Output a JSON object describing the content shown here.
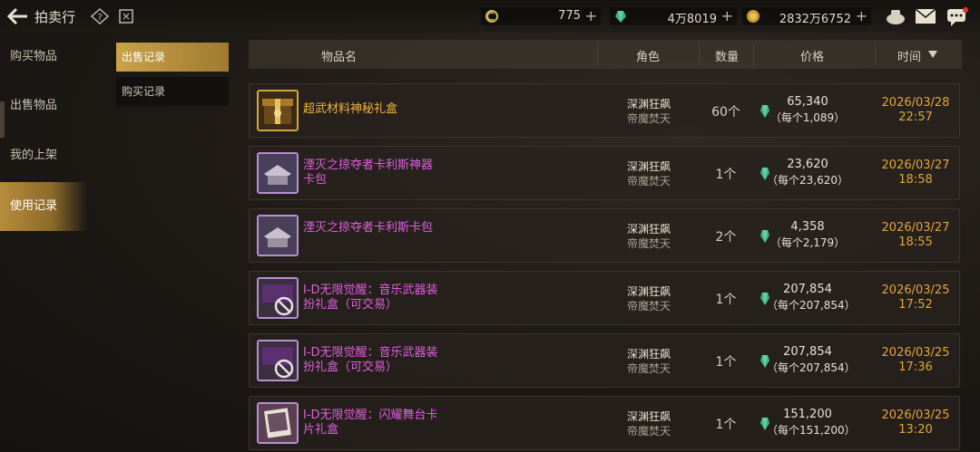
{
  "header": {
    "title": "拍卖行",
    "currencies": [
      {
        "icon": "coin-icon",
        "value": "775"
      },
      {
        "icon": "gem-icon",
        "value": "4万8019"
      },
      {
        "icon": "gold-icon",
        "value": "2832万6752"
      }
    ],
    "plus": "+"
  },
  "leftnav": {
    "items": [
      {
        "label": "购买物品"
      },
      {
        "label": "出售物品"
      },
      {
        "label": "我的上架"
      },
      {
        "label": "使用记录"
      }
    ],
    "active_index": 3
  },
  "subnav": {
    "items": [
      {
        "label": "出售记录"
      },
      {
        "label": "购买记录"
      }
    ],
    "active_index": 0
  },
  "table": {
    "headers": {
      "name": "物品名",
      "role": "角色",
      "qty": "数量",
      "price": "价格",
      "time": "时间"
    },
    "rows": [
      {
        "name": "超武材料神秘礼盒",
        "name_color": "#f0b23a",
        "icon": "mystery-box-icon",
        "role": "深渊狂飙",
        "server": "帝魔焚天",
        "qty": "60个",
        "price": "65,340",
        "unit_price": "（每个1,089）",
        "date": "2026/03/28",
        "time": "22:57"
      },
      {
        "name": "湮灭之掠夺者卡利斯神器卡包",
        "name_color": "#e05ee0",
        "icon": "card-pack-icon",
        "role": "深渊狂飙",
        "server": "帝魔焚天",
        "qty": "1个",
        "price": "23,620",
        "unit_price": "（每个23,620）",
        "date": "2026/03/27",
        "time": "18:58"
      },
      {
        "name": "湮灭之掠夺者卡利斯卡包",
        "name_color": "#e05ee0",
        "icon": "card-pack-icon",
        "role": "深渊狂飙",
        "server": "帝魔焚天",
        "qty": "2个",
        "price": "4,358",
        "unit_price": "（每个2,179）",
        "date": "2026/03/27",
        "time": "18:55"
      },
      {
        "name": "I-D无限觉醒：音乐武器装扮礼盒（可交易）",
        "name_color": "#e05ee0",
        "icon": "weapon-skin-box-icon",
        "role": "深渊狂飙",
        "server": "帝魔焚天",
        "qty": "1个",
        "price": "207,854",
        "unit_price": "（每个207,854）",
        "date": "2026/03/25",
        "time": "17:52"
      },
      {
        "name": "I-D无限觉醒：音乐武器装扮礼盒（可交易）",
        "name_color": "#e05ee0",
        "icon": "weapon-skin-box-icon",
        "role": "深渊狂飙",
        "server": "帝魔焚天",
        "qty": "1个",
        "price": "207,854",
        "unit_price": "（每个207,854）",
        "date": "2026/03/25",
        "time": "17:36"
      },
      {
        "name": "I-D无限觉醒：闪耀舞台卡片礼盒",
        "name_color": "#e05ee0",
        "icon": "card-box-icon",
        "role": "深渊狂飙",
        "server": "帝魔焚天",
        "qty": "1个",
        "price": "151,200",
        "unit_price": "（每个151,200）",
        "date": "2026/03/25",
        "time": "13:20"
      }
    ]
  }
}
